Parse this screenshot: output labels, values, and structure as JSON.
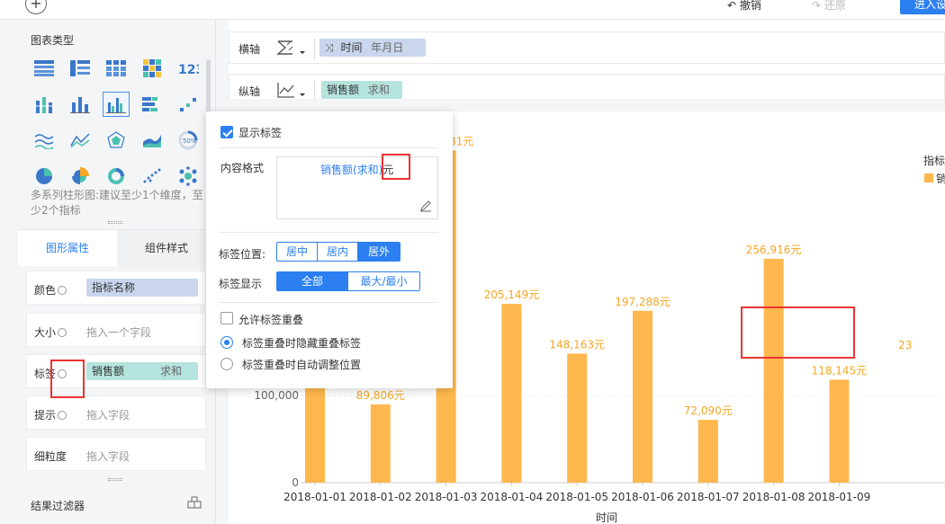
{
  "topbar": {
    "plus": "+",
    "undo": "撤销",
    "redo": "还原",
    "enter": "进入设"
  },
  "sidebar": {
    "chart_type_title": "图表类型",
    "chart_desc": "多系列柱形图:建议至少1个维度，至少2个指标",
    "tabs": [
      "图形属性",
      "组件样式"
    ],
    "props": [
      {
        "label": "颜色",
        "pill": "指标名称",
        "pill_type": "blue"
      },
      {
        "label": "大小",
        "placeholder": "拖入一个字段"
      },
      {
        "label": "标签",
        "pill": "销售额",
        "agg": "求和",
        "pill_type": "green"
      },
      {
        "label": "提示",
        "placeholder": "拖入字段"
      },
      {
        "label": "细粒度",
        "placeholder": "拖入字段"
      }
    ],
    "filter_title": "结果过滤器"
  },
  "axes": {
    "x_label": "横轴",
    "x_field": "时间",
    "x_sub": "年月日",
    "y_label": "纵轴",
    "y_field": "销售额",
    "y_agg": "求和"
  },
  "popup": {
    "show_label": "显示标签",
    "show_label_checked": true,
    "content_format_label": "内容格式",
    "format_field": "销售额(求和)",
    "format_suffix": "元",
    "position_label": "标签位置:",
    "positions": [
      "居中",
      "居内",
      "居外"
    ],
    "position_selected": 2,
    "display_label": "标签显示",
    "displays": [
      "全部",
      "最大/最小"
    ],
    "display_selected": 0,
    "allow_overlap": "允许标签重叠",
    "overlap_hide": "标签重叠时隐藏重叠标签",
    "overlap_adjust": "标签重叠时自动调整位置"
  },
  "legend": {
    "title": "指标",
    "item": "销"
  },
  "chart_data": {
    "type": "bar",
    "xlabel": "时间",
    "categories": [
      "2018-01-01",
      "2018-01-02",
      "2018-01-03",
      "2018-01-04",
      "2018-01-05",
      "2018-01-06",
      "2018-01-07",
      "2018-01-08",
      "2018-01-09"
    ],
    "values": [
      210000,
      89806,
      381281,
      205149,
      148163,
      197288,
      72090,
      256916,
      118145
    ],
    "labels": [
      "",
      "89,806元",
      "381,281元",
      "205,149元",
      "148,163元",
      "197,288元",
      "72,090元",
      "256,916元",
      "118,145元"
    ],
    "yticks": [
      "0",
      "100,000"
    ],
    "ytick_values": [
      0,
      100000
    ],
    "ylim": [
      0,
      424000
    ],
    "color": "#ffb84d",
    "label_color": "#f5a623",
    "offscreen_label": "23"
  },
  "colors": {
    "accent": "#2b7ff0",
    "bar": "#ffb84d",
    "highlight": "#e33333"
  }
}
